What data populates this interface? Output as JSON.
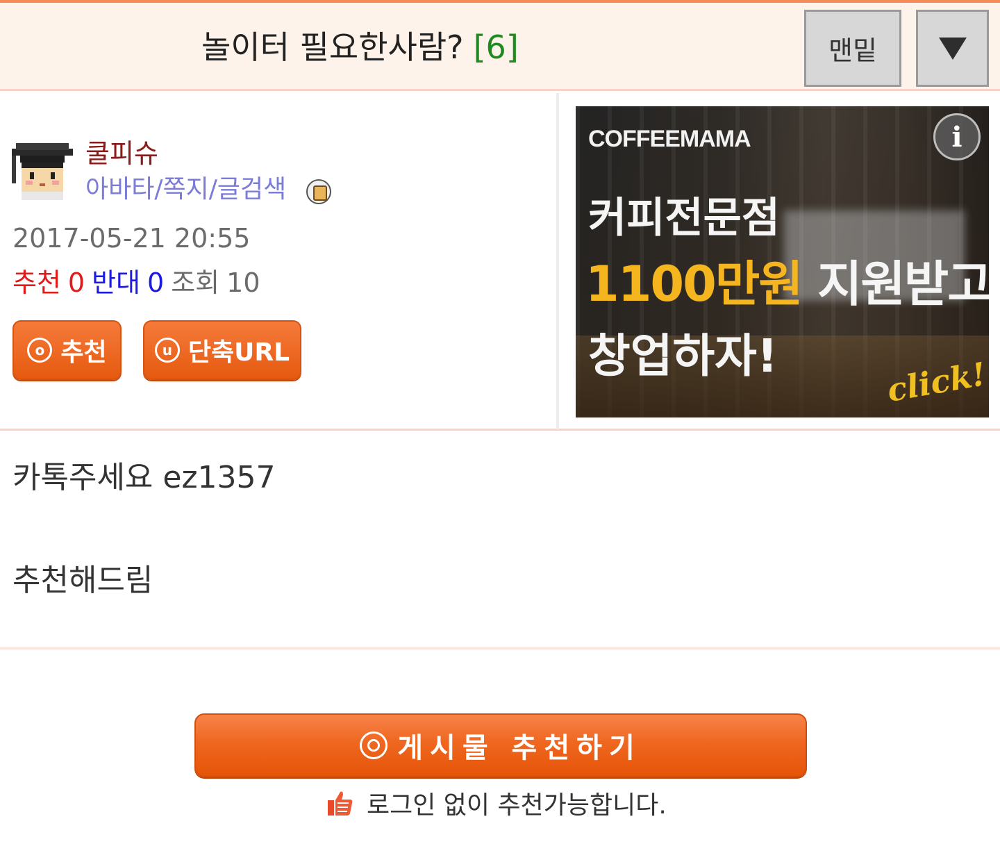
{
  "header": {
    "title": "놀이터 필요한사람?",
    "comment_count": "[6]",
    "bottom_button": "맨밑",
    "dropdown_icon": "down-triangle-icon"
  },
  "author": {
    "name": "쿨피슈",
    "links": "아바타/쪽지/글검색",
    "avatar_icon": "graduate-avatar-icon",
    "badge_icon": "level-badge-icon"
  },
  "post": {
    "date": "2017-05-21 20:55",
    "stats": {
      "recommend_label": "추천",
      "recommend_value": "0",
      "oppose_label": "반대",
      "oppose_value": "0",
      "views_label": "조회",
      "views_value": "10"
    },
    "actions": {
      "recommend": "추천",
      "short_url": "단축URL"
    },
    "body": [
      "카톡주세요 ez1357",
      "추천해드림"
    ]
  },
  "ad": {
    "brand": "COFFEEMAMA",
    "info_icon": "i",
    "line1": "커피전문점",
    "line2_highlight": "1100만원",
    "line2_rest": "지원받고",
    "line3": "창업하자!",
    "cta": "click!"
  },
  "footer": {
    "recommend_button": "게시물  추천하기",
    "note": "로그인 없이 추천가능합니다."
  },
  "colors": {
    "accent_orange": "#ef6720",
    "header_bg": "#fdf3ea",
    "separator": "#f9d3c9",
    "recommend_red": "#e01b1b",
    "oppose_blue": "#1a1ae0",
    "count_green": "#1f8a1f"
  }
}
